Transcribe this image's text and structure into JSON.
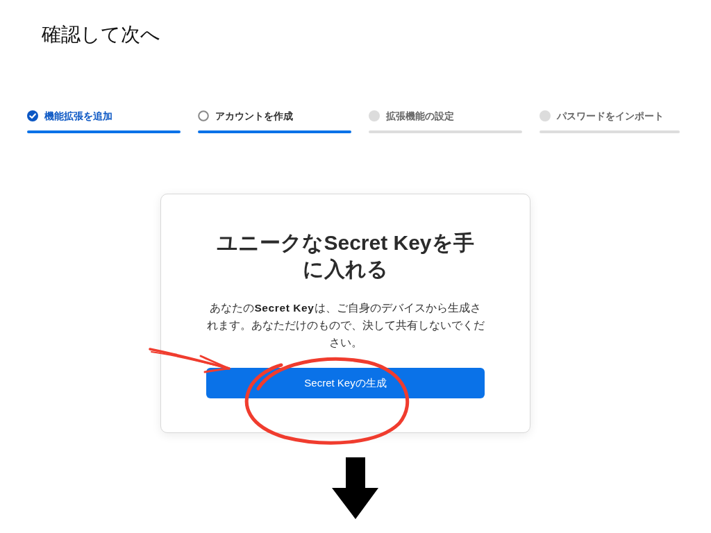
{
  "heading": "確認して次へ",
  "steps": [
    {
      "label": "機能拡張を追加",
      "completed": true,
      "selected": false
    },
    {
      "label": "アカウントを作成",
      "completed": false,
      "selected": true
    },
    {
      "label": "拡張機能の設定",
      "completed": false,
      "selected": false
    },
    {
      "label": "パスワードをインポート",
      "completed": false,
      "selected": false
    }
  ],
  "card": {
    "title": "ユニークなSecret Keyを手に入れる",
    "description": "あなたの**Secret Key**は、ご自身のデバイスから生成されます。あなただけのもので、決して共有しないでください。",
    "button": "Secret Keyの生成"
  }
}
